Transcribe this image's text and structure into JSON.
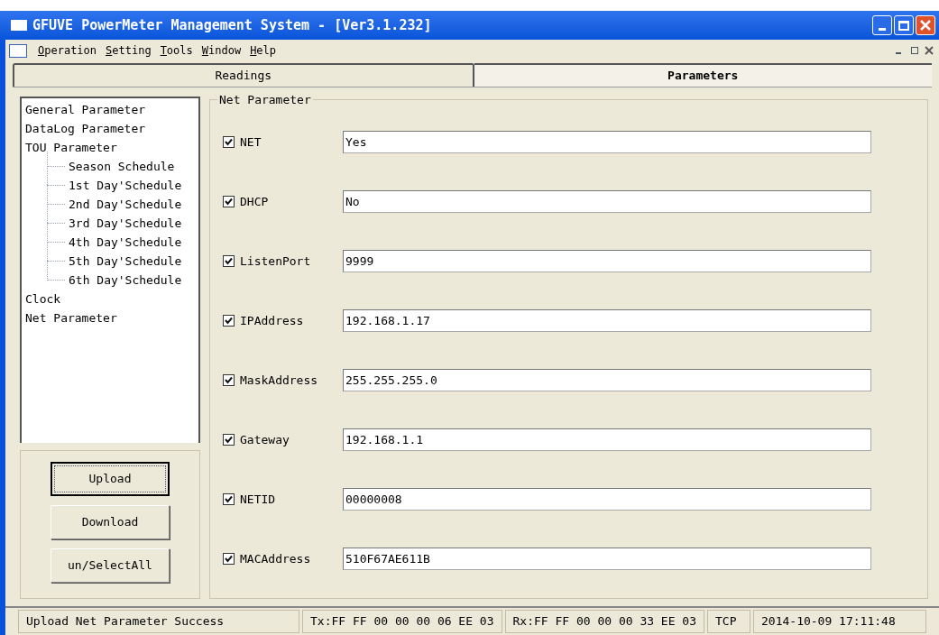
{
  "window": {
    "title": "GFUVE PowerMeter Management System - [Ver3.1.232]"
  },
  "menu": [
    "Operation",
    "Setting",
    "Tools",
    "Window",
    "Help"
  ],
  "tabs": [
    {
      "label": "Readings",
      "selected": false
    },
    {
      "label": "Parameters",
      "selected": true
    }
  ],
  "tree": [
    {
      "label": "General Parameter"
    },
    {
      "label": "DataLog Parameter"
    },
    {
      "label": "TOU Parameter",
      "children": [
        {
          "label": "Season Schedule"
        },
        {
          "label": "1st Day'Schedule"
        },
        {
          "label": "2nd Day'Schedule"
        },
        {
          "label": "3rd Day'Schedule"
        },
        {
          "label": "4th Day'Schedule"
        },
        {
          "label": "5th Day'Schedule"
        },
        {
          "label": "6th Day'Schedule"
        }
      ]
    },
    {
      "label": "Clock"
    },
    {
      "label": "Net Parameter"
    }
  ],
  "buttons": [
    {
      "label": "Upload",
      "focused": true
    },
    {
      "label": "Download",
      "focused": false
    },
    {
      "label": "un/SelectAll",
      "focused": false
    }
  ],
  "group": {
    "title": "Net Parameter",
    "fields": [
      {
        "label": "NET",
        "checked": true,
        "value": "Yes"
      },
      {
        "label": "DHCP",
        "checked": true,
        "value": "No"
      },
      {
        "label": "ListenPort",
        "checked": true,
        "value": "9999"
      },
      {
        "label": "IPAddress",
        "checked": true,
        "value": "192.168.1.17"
      },
      {
        "label": "MaskAddress",
        "checked": true,
        "value": "255.255.255.0"
      },
      {
        "label": "Gateway",
        "checked": true,
        "value": "192.168.1.1"
      },
      {
        "label": "NETID",
        "checked": true,
        "value": "00000008"
      },
      {
        "label": "MACAddress",
        "checked": true,
        "value": "510F67AE611B"
      }
    ]
  },
  "status_bar": [
    "Upload Net Parameter Success",
    "Tx:FF FF 00 00 00 06 EE 03",
    "Rx:FF FF 00 00 00 33 EE 03",
    "TCP",
    "2014-10-09 17:11:48"
  ]
}
